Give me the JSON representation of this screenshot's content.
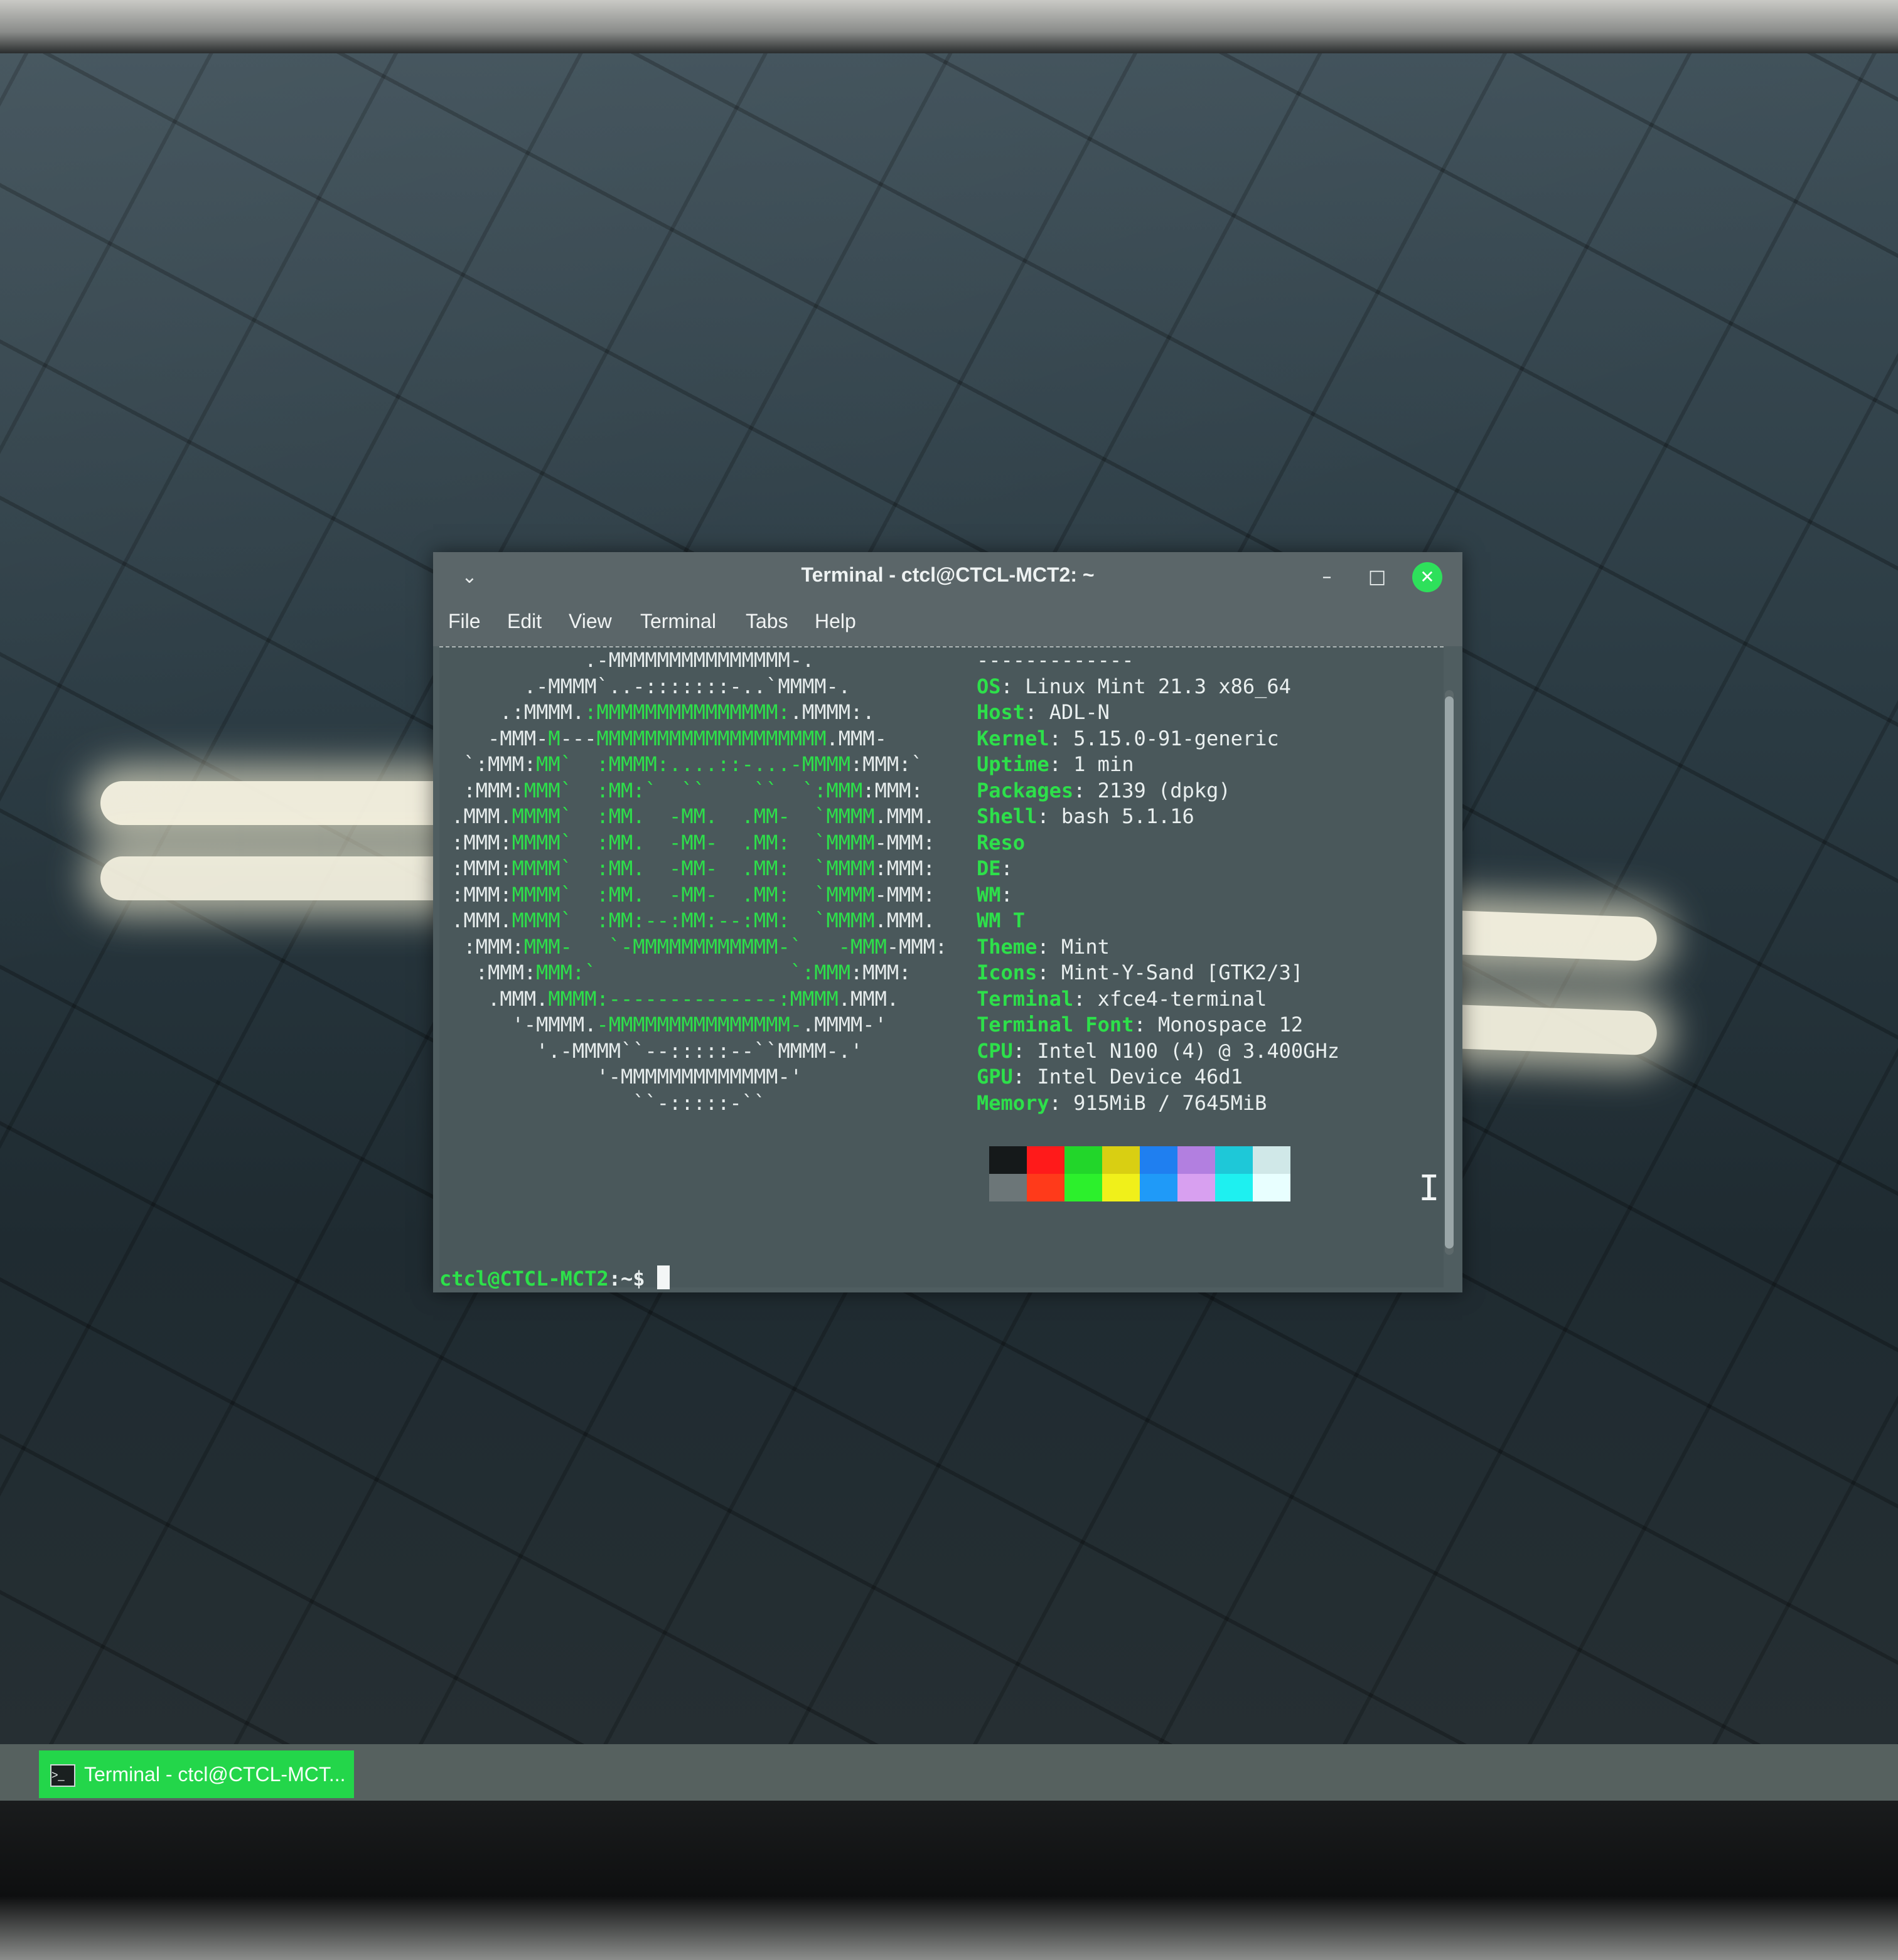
{
  "window": {
    "title": "Terminal - ctcl@CTCL-MCT2: ~",
    "menu_glyph": "⌄",
    "minimize_glyph": "–",
    "maximize_glyph": "□",
    "close_glyph": "✕"
  },
  "menubar": {
    "items": [
      "File",
      "Edit",
      "View",
      "Terminal",
      "Tabs",
      "Help"
    ]
  },
  "neofetch": {
    "separator": "-------------",
    "rows": [
      {
        "key": "OS",
        "value": ": Linux Mint 21.3 x86_64"
      },
      {
        "key": "Host",
        "value": ": ADL-N"
      },
      {
        "key": "Kernel",
        "value": ": 5.15.0-91-generic"
      },
      {
        "key": "Uptime",
        "value": ": 1 min"
      },
      {
        "key": "Packages",
        "value": ": 2139 (dpkg)"
      },
      {
        "key": "Shell",
        "value": ": bash 5.1.16"
      },
      {
        "key": "Reso",
        "value": ""
      },
      {
        "key": "DE",
        "value": ":"
      },
      {
        "key": "WM",
        "value": ":"
      },
      {
        "key": "WM T",
        "value": ""
      },
      {
        "key": "Theme",
        "value": ": Mint"
      },
      {
        "key": "Icons",
        "value": ": Mint-Y-Sand [GTK2/3]"
      },
      {
        "key": "Terminal",
        "value": ": xfce4-terminal"
      },
      {
        "key": "Terminal Font",
        "value": ": Monospace 12"
      },
      {
        "key": "CPU",
        "value": ": Intel N100 (4) @ 3.400GHz"
      },
      {
        "key": "GPU",
        "value": ": Intel Device 46d1"
      },
      {
        "key": "Memory",
        "value": ": 915MiB / 7645MiB"
      }
    ],
    "palette_top": [
      "#15191a",
      "#ff1a1a",
      "#22d62a",
      "#d9cf12",
      "#1f7ff0",
      "#b27fe0",
      "#1ec8d8",
      "#d0e8e8"
    ],
    "palette_bottom": [
      "#6c7678",
      "#ff3a1a",
      "#2cf02c",
      "#f0f01a",
      "#1f9af8",
      "#d8a0f0",
      "#1ef0f0",
      "#e8ffff"
    ]
  },
  "ascii_logo": [
    [
      [
        "            ",
        "w"
      ],
      [
        ".-MMMMMMMMMMMMMMM-.",
        "w"
      ]
    ],
    [
      [
        "       ",
        "w"
      ],
      [
        ".-MMMM`..-:::::::-..`MMMM-.",
        "w"
      ]
    ],
    [
      [
        "     ",
        "w"
      ],
      [
        ".:MMMM.",
        "w"
      ],
      [
        ":MMMMMMMMMMMMMMM:",
        "g"
      ],
      [
        ".MMMM:.",
        "w"
      ]
    ],
    [
      [
        "    ",
        "w"
      ],
      [
        "-MMM-",
        "w"
      ],
      [
        "M",
        "g"
      ],
      [
        "---",
        "w"
      ],
      [
        "MMMMMMMMMMMMMMMMMMM",
        "g"
      ],
      [
        ".MMM-",
        "w"
      ]
    ],
    [
      [
        "  ",
        "w"
      ],
      [
        "`:MMM:",
        "w"
      ],
      [
        "MM`",
        "g"
      ],
      [
        "  :MMMM:....::-...-",
        "g"
      ],
      [
        "MMMM",
        "g"
      ],
      [
        ":MMM:`",
        "w"
      ]
    ],
    [
      [
        "  ",
        "w"
      ],
      [
        ":MMM:",
        "w"
      ],
      [
        "MMM`",
        "g"
      ],
      [
        "  :MM:`  ``    ``  `:",
        "g"
      ],
      [
        "MMM",
        "g"
      ],
      [
        ":MMM:",
        "w"
      ]
    ],
    [
      [
        " ",
        "w"
      ],
      [
        ".MMM.",
        "w"
      ],
      [
        "MMMM`",
        "g"
      ],
      [
        "  :MM.  -MM.  .MM-  `",
        "g"
      ],
      [
        "MMMM",
        "g"
      ],
      [
        ".MMM.",
        "w"
      ]
    ],
    [
      [
        " ",
        "w"
      ],
      [
        ":MMM:",
        "w"
      ],
      [
        "MMMM`",
        "g"
      ],
      [
        "  :MM.  -MM-  .MM:  `",
        "g"
      ],
      [
        "MMMM",
        "g"
      ],
      [
        "-MMM:",
        "w"
      ]
    ],
    [
      [
        " ",
        "w"
      ],
      [
        ":MMM:",
        "w"
      ],
      [
        "MMMM`",
        "g"
      ],
      [
        "  :MM.  -MM-  .MM:  `",
        "g"
      ],
      [
        "MMMM",
        "g"
      ],
      [
        ":MMM:",
        "w"
      ]
    ],
    [
      [
        " ",
        "w"
      ],
      [
        ":MMM:",
        "w"
      ],
      [
        "MMMM`",
        "g"
      ],
      [
        "  :MM.  -MM-  .MM:  `",
        "g"
      ],
      [
        "MMMM",
        "g"
      ],
      [
        "-MMM:",
        "w"
      ]
    ],
    [
      [
        " ",
        "w"
      ],
      [
        ".MMM.",
        "w"
      ],
      [
        "MMMM`",
        "g"
      ],
      [
        "  :MM:--:MM:--:MM:  `",
        "g"
      ],
      [
        "MMMM",
        "g"
      ],
      [
        ".MMM.",
        "w"
      ]
    ],
    [
      [
        "  ",
        "w"
      ],
      [
        ":MMM:",
        "w"
      ],
      [
        "MMM-",
        "g"
      ],
      [
        "   `-MMMMMMMMMMMM-`   -",
        "g"
      ],
      [
        "MMM",
        "g"
      ],
      [
        "-MMM:",
        "w"
      ]
    ],
    [
      [
        "   ",
        "w"
      ],
      [
        ":MMM:",
        "w"
      ],
      [
        "MMM:`",
        "g"
      ],
      [
        "                `:",
        "g"
      ],
      [
        "MMM",
        "g"
      ],
      [
        ":MMM:",
        "w"
      ]
    ],
    [
      [
        "    ",
        "w"
      ],
      [
        ".MMM.",
        "w"
      ],
      [
        "MMMM:--------------:MMMM",
        "g"
      ],
      [
        ".MMM.",
        "w"
      ]
    ],
    [
      [
        "      ",
        "w"
      ],
      [
        "'-MMMM.",
        "w"
      ],
      [
        "-MMMMMMMMMMMMMMM-",
        "g"
      ],
      [
        ".MMMM-'",
        "w"
      ]
    ],
    [
      [
        "        ",
        "w"
      ],
      [
        "'.-MMMM``--:::::--``MMMM-.'",
        "w"
      ]
    ],
    [
      [
        "             ",
        "w"
      ],
      [
        "'-MMMMMMMMMMMMM-'",
        "w"
      ]
    ],
    [
      [
        "                ",
        "w"
      ],
      [
        "``-:::::-``",
        "w"
      ]
    ]
  ],
  "prompt": {
    "userhost": "ctcl@CTCL-MCT2",
    "path_suffix": ":~$ "
  },
  "taskbar": {
    "task_label": "Terminal - ctcl@CTCL-MCT..."
  }
}
